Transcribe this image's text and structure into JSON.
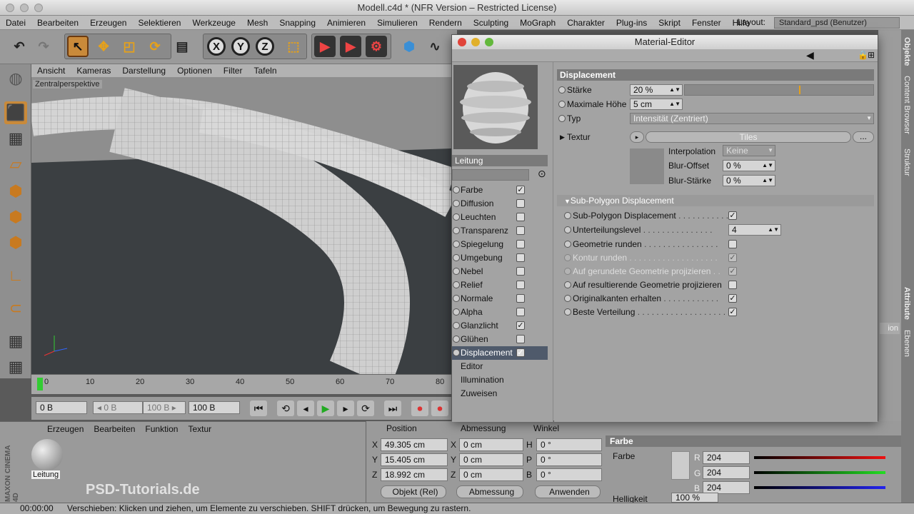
{
  "window": {
    "title": "Modell.c4d * (NFR Version – Restricted License)"
  },
  "menu": [
    "Datei",
    "Bearbeiten",
    "Erzeugen",
    "Selektieren",
    "Werkzeuge",
    "Mesh",
    "Snapping",
    "Animieren",
    "Simulieren",
    "Rendern",
    "Sculpting",
    "MoGraph",
    "Charakter",
    "Plug-ins",
    "Skript",
    "Fenster",
    "Hilfe"
  ],
  "layout": {
    "label": "Layout:",
    "value": "Standard_psd (Benutzer)"
  },
  "toolbar": {
    "x": "X",
    "y": "Y",
    "z": "Z"
  },
  "viewport_menu": [
    "Ansicht",
    "Kameras",
    "Darstellung",
    "Optionen",
    "Filter",
    "Tafeln"
  ],
  "viewport": {
    "label": "Zentralperspektive"
  },
  "timeline": {
    "ticks": [
      "0",
      "10",
      "20",
      "30",
      "40",
      "50",
      "60",
      "70",
      "80"
    ]
  },
  "transport": {
    "start": "0 B",
    "mid_a": "◂ 0 B",
    "mid_b": "100 B ▸",
    "end": "100 B"
  },
  "material_manager": {
    "menu": [
      "Erzeugen",
      "Bearbeiten",
      "Funktion",
      "Textur"
    ],
    "material_name": "Leitung"
  },
  "coords": {
    "headers": [
      "Position",
      "Abmessung",
      "Winkel"
    ],
    "rows": [
      {
        "a": "X",
        "pos": "49.305 cm",
        "b": "X",
        "size": "0 cm",
        "c": "H",
        "rot": "0 °"
      },
      {
        "a": "Y",
        "pos": "15.405 cm",
        "b": "Y",
        "size": "0 cm",
        "c": "P",
        "rot": "0 °"
      },
      {
        "a": "Z",
        "pos": "18.992 cm",
        "b": "Z",
        "size": "0 cm",
        "c": "B",
        "rot": "0 °"
      }
    ],
    "mode": "Objekt (Rel)",
    "size_mode": "Abmessung",
    "apply": "Anwenden"
  },
  "status": {
    "time": "00:00:00",
    "text": "Verschieben: Klicken und ziehen, um Elemente zu verschieben. SHIFT drücken, um Bewegung zu rastern."
  },
  "right_tabs": [
    "Objekte",
    "Content Browser",
    "Struktur",
    "Attribute",
    "Ebenen"
  ],
  "color_panel": {
    "title": "Farbe",
    "label": "Farbe",
    "r_label": "R",
    "r": "204",
    "g_label": "G",
    "g": "204",
    "b_label": "B",
    "b": "204",
    "brightness_label": "Helligkeit",
    "brightness": "100 %",
    "partial_btn": "ion"
  },
  "watermark": "PSD-Tutorials.de",
  "brand": "MAXON CINEMA 4D",
  "material_editor": {
    "title": "Material-Editor",
    "material_name": "Leitung",
    "channels": [
      {
        "label": "Farbe",
        "checked": "✓"
      },
      {
        "label": "Diffusion",
        "checked": ""
      },
      {
        "label": "Leuchten",
        "checked": ""
      },
      {
        "label": "Transparenz",
        "checked": ""
      },
      {
        "label": "Spiegelung",
        "checked": ""
      },
      {
        "label": "Umgebung",
        "checked": ""
      },
      {
        "label": "Nebel",
        "checked": ""
      },
      {
        "label": "Relief",
        "checked": ""
      },
      {
        "label": "Normale",
        "checked": ""
      },
      {
        "label": "Alpha",
        "checked": ""
      },
      {
        "label": "Glanzlicht",
        "checked": "✓"
      },
      {
        "label": "Glühen",
        "checked": ""
      },
      {
        "label": "Displacement",
        "checked": "✓"
      }
    ],
    "extras": [
      "Editor",
      "Illumination",
      "Zuweisen"
    ],
    "section": "Displacement",
    "staerke_label": "Stärke",
    "staerke": "20 %",
    "hoehe_label": "Maximale Höhe",
    "hoehe": "5 cm",
    "typ_label": "Typ",
    "typ": "Intensität (Zentriert)",
    "textur_label": "Textur",
    "textur": "Tiles",
    "more": "...",
    "interp_label": "Interpolation",
    "interp": "Keine",
    "blur_off_label": "Blur-Offset",
    "blur_off": "0 %",
    "blur_str_label": "Blur-Stärke",
    "blur_str": "0 %",
    "subsection": "Sub-Polygon Displacement",
    "sub": [
      {
        "label": "Sub-Polygon Displacement",
        "checked": "✓",
        "dim": false
      },
      {
        "label": "Unterteilungslevel",
        "value": "4"
      },
      {
        "label": "Geometrie runden",
        "checked": "",
        "dim": false
      },
      {
        "label": "Kontur runden",
        "checked": "✓",
        "dim": true
      },
      {
        "label": "Auf gerundete Geometrie projizieren",
        "checked": "✓",
        "dim": true
      },
      {
        "label": "Auf resultierende Geometrie projizieren",
        "checked": "",
        "dim": false
      },
      {
        "label": "Originalkanten erhalten",
        "checked": "✓",
        "dim": false
      },
      {
        "label": "Beste Verteilung",
        "checked": "✓",
        "dim": false
      }
    ]
  }
}
